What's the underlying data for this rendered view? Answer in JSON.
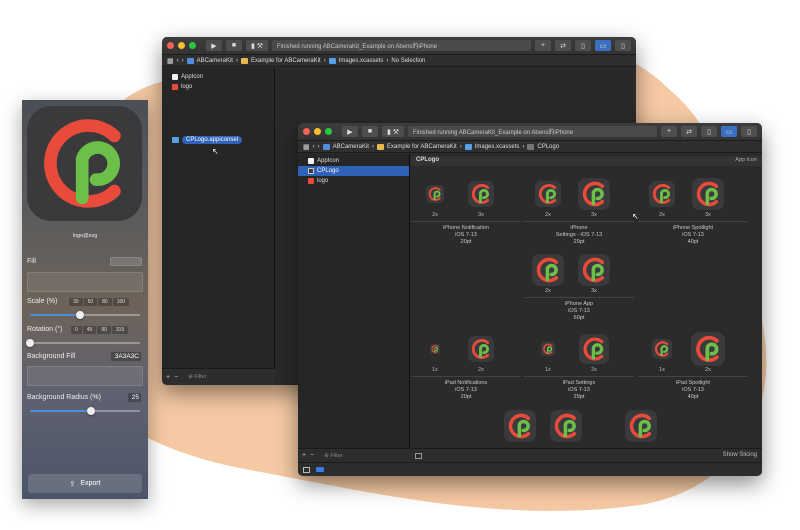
{
  "colors": {
    "blob": "#f5c9a3",
    "accent_blue": "#4c8fe0",
    "logo_red": "#e84b3a",
    "logo_green": "#6cc04a",
    "icon_bg": "#3a3a3c"
  },
  "back_window": {
    "status": "Finished running ABCameraKit_Example on Abens的iPhone",
    "breadcrumb": [
      "ABCameraKit",
      "Example for ABCameraKit",
      "Images.xcassets",
      "No Selection"
    ],
    "nav_items": [
      {
        "label": "AppIcon",
        "icon": "appicon-icon"
      },
      {
        "label": "logo",
        "icon": "image-icon"
      }
    ],
    "drag_label": "CPLogo.appiconset",
    "filter": "Filter"
  },
  "front_window": {
    "status": "Finished running ABCameraKit_Example on Abens的iPhone",
    "breadcrumb": [
      "ABCameraKit",
      "Example for ABCameraKit",
      "Images.xcassets",
      "CPLogo"
    ],
    "nav_items": [
      {
        "label": "AppIcon",
        "icon": "appicon-icon"
      },
      {
        "label": "CPLogo",
        "icon": "appicon-icon",
        "selected": true
      },
      {
        "label": "logo",
        "icon": "image-icon"
      }
    ],
    "filter": "Filter",
    "title": "CPLogo",
    "badge": "App Icon",
    "show_slicing": "Show Slicing",
    "groups": [
      {
        "l1": "iPhone Notification",
        "l2": "iOS 7-13",
        "l3": "20pt",
        "s1": "2x",
        "s2": "3x"
      },
      {
        "l1": "iPhone",
        "l2": "Settings - iOS 7-13",
        "l3": "29pt",
        "s1": "2x",
        "s2": "3x"
      },
      {
        "l1": "iPhone Spotlight",
        "l2": "iOS 7-13",
        "l3": "40pt",
        "s1": "2x",
        "s2": "3x"
      },
      {
        "l1": "iPhone App",
        "l2": "iOS 7-13",
        "l3": "60pt",
        "s1": "2x",
        "s2": "3x"
      },
      {
        "l1": "iPad Notifications",
        "l2": "iOS 7-13",
        "l3": "20pt",
        "s1": "1x",
        "s2": "2x"
      },
      {
        "l1": "iPad Settings",
        "l2": "iOS 7-13",
        "l3": "29pt",
        "s1": "1x",
        "s2": "2x"
      },
      {
        "l1": "iPad Spotlight",
        "l2": "iOS 7-13",
        "l3": "40pt",
        "s1": "1x",
        "s2": "2x"
      }
    ]
  },
  "left_panel": {
    "logo_name": "logo@svg",
    "fill_label": "Fill",
    "scale_label": "Scale (%)",
    "scale_presets": [
      "30",
      "50",
      "80",
      "100"
    ],
    "scale_value_fraction": 0.45,
    "rotation_label": "Rotation (°)",
    "rotation_presets": [
      "0",
      "45",
      "90",
      "315"
    ],
    "rotation_value_fraction": 0.0,
    "bg_fill_label": "Background Fill",
    "bg_fill_value": "3A3A3C",
    "bg_radius_label": "Background Radius (%)",
    "bg_radius_value": "25",
    "bg_radius_fraction": 0.55,
    "export_label": "Export"
  }
}
